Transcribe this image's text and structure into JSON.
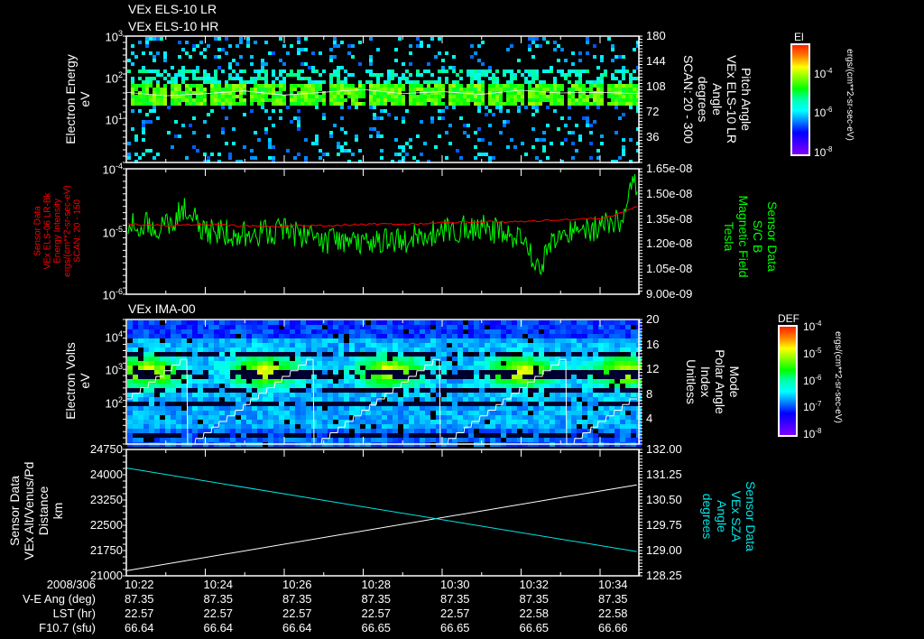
{
  "titles": [
    "VEx ELS-10 LR",
    "VEx ELS-10 HR"
  ],
  "ima_title": "VEx IMA-00",
  "colors": {
    "background": "#000000",
    "axis": "#ffffff",
    "red_series": "#ff0000",
    "green_series": "#00ff00",
    "cyan_series": "#00e5e5"
  },
  "panel1": {
    "left_label": [
      "Electron Energy",
      "eV"
    ],
    "right_label": [
      "Pitch Angle",
      "VEx ELS-10 LR",
      "Angle",
      "degrees",
      "SCAN: 20 - 300"
    ],
    "colorbar": {
      "title": "El",
      "ticks": [
        {
          "b": "10",
          "e": "-4"
        },
        {
          "b": "10",
          "e": "-6"
        },
        {
          "b": "10",
          "e": "-8"
        }
      ],
      "unit": "ergs/(cm**2-sr-sec-eV)"
    }
  },
  "panel2": {
    "left_label": [
      "Sensor Data",
      "VEx ELS-06 LR-Bk",
      "Energy Intensity",
      "ergs/(cm**2-sr-sec-eV)",
      "SCAN: 20 - 150"
    ],
    "right_label": [
      "Sensor Data",
      "S/C B",
      "Magnetic Field",
      "Tesla"
    ]
  },
  "panel3": {
    "left_label": [
      "Electron Volts",
      "eV"
    ],
    "right_label": [
      "Mode",
      "Polar Angle",
      "Index",
      "Unitless"
    ],
    "colorbar": {
      "title": "DEF",
      "ticks": [
        {
          "b": "10",
          "e": "-4"
        },
        {
          "b": "10",
          "e": "-5"
        },
        {
          "b": "10",
          "e": "-6"
        },
        {
          "b": "10",
          "e": "-7"
        },
        {
          "b": "10",
          "e": "-8"
        }
      ],
      "unit": "ergs/(cm**2-sr-sec-eV)"
    }
  },
  "panel4": {
    "left_label": [
      "Sensor Data",
      "VEx Alt/Venus/Pd",
      "Distance",
      "km"
    ],
    "right_label": [
      "Sensor Data",
      "VEx SZA",
      "Angle",
      "degrees"
    ]
  },
  "chart_data": [
    {
      "type": "heatmap",
      "name": "ELS electron energy spectrogram",
      "ylabel": "Electron Energy (eV)",
      "ylim_log10": [
        -0.04,
        3
      ],
      "yticks": [
        {
          "v": 1,
          "b": "10",
          "e": "1"
        },
        {
          "v": 2,
          "b": "10",
          "e": "2"
        },
        {
          "v": 3,
          "b": "10",
          "e": "3"
        }
      ],
      "y2label": "Pitch Angle (degrees)",
      "y2lim": [
        0,
        180
      ],
      "y2ticks": [
        36,
        72,
        108,
        144,
        180
      ],
      "band_log10_eV": [
        1.35,
        1.9
      ],
      "pitch_angle_line_deg": [
        100,
        95,
        98,
        102,
        96,
        100,
        104,
        98,
        101,
        97,
        103,
        99,
        100,
        98
      ]
    },
    {
      "type": "line",
      "name": "ELS background intensity and magnetic field",
      "ylim": [
        1e-06,
        0.0001
      ],
      "yscale": "log",
      "yticks": [
        {
          "v": -4,
          "b": "10",
          "e": "-4"
        },
        {
          "v": -5,
          "b": "10",
          "e": "-5"
        },
        {
          "v": -6,
          "b": "10",
          "e": "-6"
        }
      ],
      "y2lim": [
        9e-09,
        1.65e-08
      ],
      "y2ticks": [
        "1.65e-08",
        "1.50e-08",
        "1.35e-08",
        "1.20e-08",
        "1.05e-08",
        "9.00e-09"
      ],
      "series": [
        {
          "name": "Energy Intensity",
          "color": "#ff0000",
          "axis": "left",
          "t_min": [
            0,
            1,
            2,
            3,
            4,
            5,
            6,
            7,
            8,
            9,
            10,
            11,
            12,
            12.5,
            12.93
          ],
          "values": [
            1.3e-05,
            1.25e-05,
            1.3e-05,
            1.22e-05,
            1.2e-05,
            1.25e-05,
            1.3e-05,
            1.32e-05,
            1.38e-05,
            1.42e-05,
            1.45e-05,
            1.55e-05,
            1.6e-05,
            1.9e-05,
            2.5e-05
          ]
        },
        {
          "name": "S/C B Magnetic Field",
          "color": "#00ff00",
          "axis": "right",
          "t_min": [
            0,
            1,
            1.5,
            2,
            3,
            4,
            5,
            6,
            7,
            8,
            9,
            10,
            10.5,
            10.7,
            11,
            12,
            12.6,
            12.85,
            12.93
          ],
          "values": [
            1.32e-08,
            1.3e-08,
            1.42e-08,
            1.28e-08,
            1.26e-08,
            1.28e-08,
            1.22e-08,
            1.2e-08,
            1.22e-08,
            1.28e-08,
            1.3e-08,
            1.24e-08,
            1.02e-08,
            1.22e-08,
            1.25e-08,
            1.3e-08,
            1.35e-08,
            1.62e-08,
            1.55e-08
          ]
        }
      ]
    },
    {
      "type": "heatmap",
      "name": "IMA electron volts spectrogram",
      "ylabel": "Electron Volts (eV)",
      "ylim_log10": [
        0.72,
        4.53
      ],
      "yticks": [
        {
          "v": 2,
          "b": "10",
          "e": "2"
        },
        {
          "v": 3,
          "b": "10",
          "e": "3"
        },
        {
          "v": 4,
          "b": "10",
          "e": "4"
        }
      ],
      "y2lim": [
        0,
        20
      ],
      "y2ticks": [
        4,
        8,
        12,
        16,
        20
      ],
      "peak_times_min": [
        0.46,
        3.43,
        6.63,
        9.94,
        12.57
      ],
      "peak_log10_eV": 3.0,
      "mode_reset_times_min": [
        1.55,
        4.75,
        7.95,
        11.15
      ],
      "mode_period_min": 3.2,
      "mode_max": 14.5
    },
    {
      "type": "line",
      "name": "Altitude and SZA",
      "ylim": [
        21000,
        24750
      ],
      "yticks": [
        21000,
        21750,
        22500,
        23250,
        24000,
        24750
      ],
      "y2lim": [
        128.25,
        132.0
      ],
      "y2ticks": [
        "128.25",
        "129.00",
        "129.75",
        "130.50",
        "131.25",
        "132.00"
      ],
      "series": [
        {
          "name": "Distance (km)",
          "color": "#ffffff",
          "axis": "left",
          "t_min": [
            0,
            12.93
          ],
          "values": [
            21150,
            23700
          ]
        },
        {
          "name": "SZA (degrees)",
          "color": "#00e5e5",
          "axis": "right",
          "t_min": [
            0,
            12.93
          ],
          "values": [
            131.45,
            128.97
          ]
        }
      ]
    }
  ],
  "time_axis": {
    "date": "2008/306",
    "row_labels": [
      "V-E Ang (deg)",
      "LST (hr)",
      "F10.7 (sfu)"
    ],
    "columns": [
      {
        "time": "10:22",
        "vea": "87.35",
        "lst": "22.57",
        "f107": "66.64"
      },
      {
        "time": "10:24",
        "vea": "87.35",
        "lst": "22.57",
        "f107": "66.64"
      },
      {
        "time": "10:26",
        "vea": "87.35",
        "lst": "22.57",
        "f107": "66.64"
      },
      {
        "time": "10:28",
        "vea": "87.35",
        "lst": "22.57",
        "f107": "66.65"
      },
      {
        "time": "10:30",
        "vea": "87.35",
        "lst": "22.57",
        "f107": "66.65"
      },
      {
        "time": "10:32",
        "vea": "87.35",
        "lst": "22.58",
        "f107": "66.65"
      },
      {
        "time": "10:34",
        "vea": "87.35",
        "lst": "22.58",
        "f107": "66.66"
      }
    ]
  }
}
